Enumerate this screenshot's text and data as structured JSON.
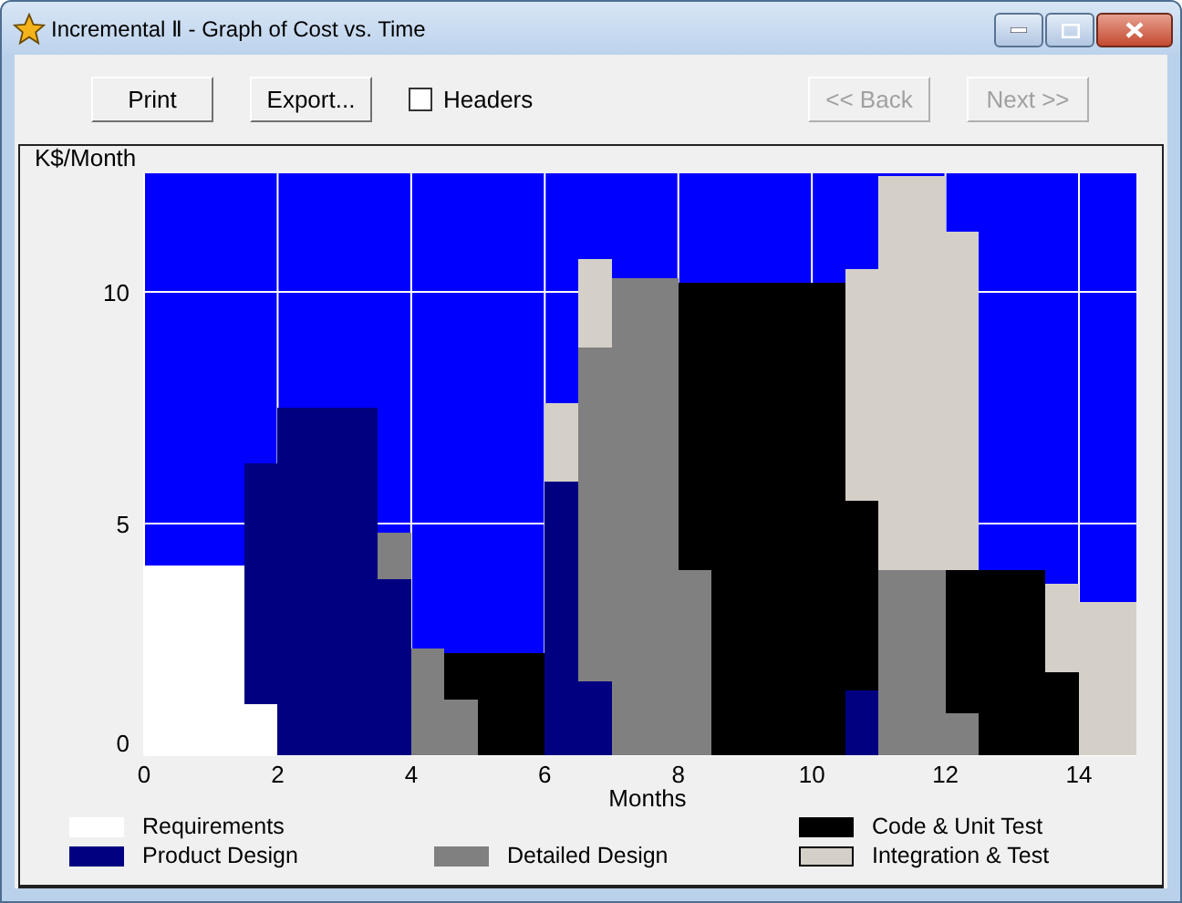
{
  "window": {
    "title": "Incremental Ⅱ - Graph of Cost vs. Time"
  },
  "toolbar": {
    "buttons": [
      {
        "label": "Print",
        "disabled": false
      },
      {
        "label": "Export...",
        "disabled": false
      }
    ],
    "headers": {
      "label": "Headers",
      "checked": false
    },
    "nav": [
      {
        "label": "<< Back",
        "disabled": true
      },
      {
        "label": "Next >>",
        "disabled": true
      }
    ]
  },
  "chart": {
    "chart_data": {
      "type": "bar",
      "stacked": true,
      "grid": true,
      "ylabel": "K$/Month",
      "xlabel": "Months",
      "x": [
        0.25,
        0.75,
        1.25,
        1.75,
        2.25,
        2.75,
        3.25,
        3.75,
        4.25,
        4.75,
        5.25,
        5.75,
        6.25,
        6.75,
        7.25,
        7.75,
        8.25,
        8.75,
        9.25,
        9.75,
        10.25,
        10.75,
        11.25,
        11.75,
        12.25,
        12.75,
        13.25,
        13.75,
        14.25,
        14.75
      ],
      "xlim": [
        0,
        14.86
      ],
      "ylim": [
        0,
        12.56
      ],
      "xticks": [
        0,
        2,
        4,
        6,
        8,
        10,
        12,
        14
      ],
      "yticks": [
        0,
        5,
        10
      ],
      "series": [
        {
          "name": "Requirements",
          "color": "#ffffff",
          "values": [
            4.1,
            4.1,
            4.1,
            1.1,
            0,
            0,
            0,
            0,
            0,
            0,
            0,
            0,
            0,
            0,
            0,
            0,
            0,
            0,
            0,
            0,
            0,
            0,
            0,
            0,
            0,
            0,
            0,
            0,
            0,
            0
          ]
        },
        {
          "name": "Product Design",
          "color": "#000080",
          "values": [
            0,
            0,
            0,
            5.2,
            7.5,
            7.5,
            7.5,
            3.8,
            0,
            0,
            0,
            0,
            5.9,
            1.6,
            0,
            0,
            0,
            0,
            0,
            0,
            0,
            1.4,
            0,
            0,
            0,
            0,
            0,
            0,
            0,
            0
          ]
        },
        {
          "name": "Detailed Design",
          "color": "#808080",
          "values": [
            0,
            0,
            0,
            0,
            0,
            0,
            0,
            1.0,
            2.3,
            1.2,
            0,
            0,
            0,
            7.2,
            10.3,
            10.3,
            4.0,
            0,
            0,
            0,
            0,
            0,
            4.0,
            4.0,
            0.9,
            0,
            0,
            0,
            0,
            0
          ]
        },
        {
          "name": "Code & Unit Test",
          "color": "#000000",
          "values": [
            0,
            0,
            0,
            0,
            0,
            0,
            0,
            0,
            0,
            1.0,
            2.2,
            2.2,
            0,
            0,
            0,
            0,
            6.2,
            10.2,
            10.2,
            10.2,
            10.2,
            4.1,
            0,
            0,
            3.1,
            4.0,
            4.0,
            1.8,
            0,
            0
          ]
        },
        {
          "name": "Integration & Test",
          "color": "#d4d0c8",
          "values": [
            0,
            0,
            0,
            0,
            0,
            0,
            0,
            0,
            0,
            0,
            0,
            0,
            1.7,
            1.9,
            0,
            0,
            0,
            0,
            0,
            0,
            0,
            5.0,
            8.5,
            8.5,
            7.3,
            0,
            0,
            1.9,
            3.3,
            3.3
          ]
        }
      ]
    }
  }
}
